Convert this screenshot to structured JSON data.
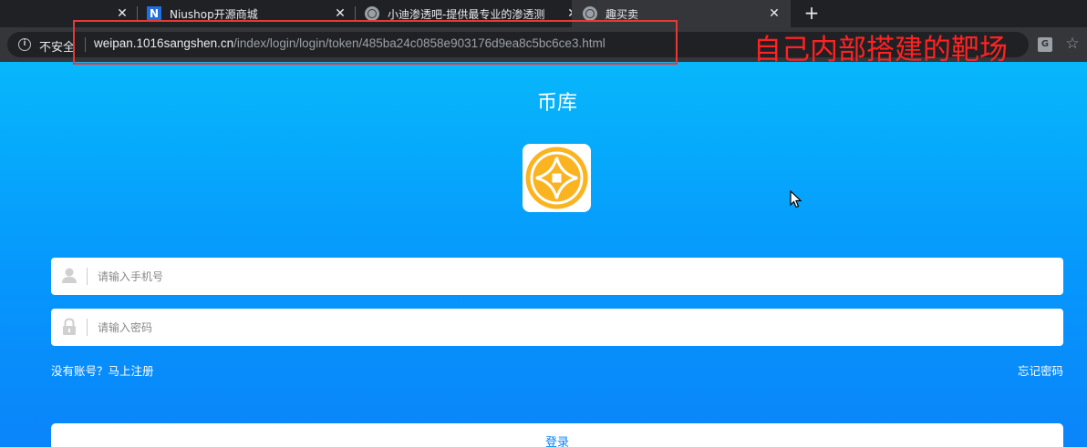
{
  "browser": {
    "tabs": [
      {
        "title": "",
        "active": false,
        "close": "✕"
      },
      {
        "title": "Niushop开源商城",
        "favicon": "N",
        "active": false,
        "close": "✕"
      },
      {
        "title": "小迪渗透吧-提供最专业的渗透测",
        "favicon": "globe-icon",
        "active": false,
        "close": "✕"
      },
      {
        "title": "趣买卖",
        "favicon": "globe-icon",
        "active": true,
        "close": "✕"
      }
    ],
    "new_tab": "+",
    "security_label": "不安全",
    "url_host": "weipan.1016sangshen.cn",
    "url_path": "/index/login/login/token/485ba24c0858e903176d9ea8c5bc6ce3.html"
  },
  "annotation": {
    "text": "自己内部搭建的靶场",
    "color": "#ff2222"
  },
  "page": {
    "title": "币库",
    "phone_placeholder": "请输入手机号",
    "password_placeholder": "请输入密码",
    "register_link": "没有账号？马上注册",
    "forgot_link": "忘记密码",
    "login_button": "登录",
    "background_top": "#07b7fb",
    "background_bottom": "#0a84fa",
    "logo_color": "#fbb320"
  }
}
